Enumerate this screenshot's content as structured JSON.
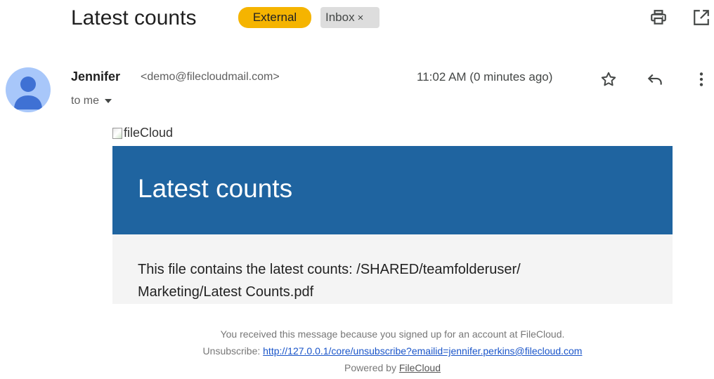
{
  "email": {
    "subject": "Latest counts",
    "labels": {
      "external": "External",
      "inbox": "Inbox",
      "inbox_close": "×"
    },
    "icons": {
      "print": "print-icon",
      "open_new_window": "open-in-new-window-icon",
      "star": "star-icon",
      "reply": "reply-icon",
      "more": "more-vertical-icon",
      "avatar": "person-avatar-icon"
    },
    "sender": {
      "name": "Jennifer",
      "email": "<demo@filecloudmail.com>",
      "recipient": "to me",
      "time": "11:02 AM (0 minutes ago)"
    }
  },
  "message": {
    "logo_alt": "fileCloud",
    "banner_title": "Latest counts",
    "body_line1": "This file contains the latest counts: /SHARED/teamfolderuser/",
    "body_line2": "Marketing/Latest Counts.pdf",
    "footer_line1": "You received this message because you signed up for an account at FileCloud.",
    "unsubscribe_label": "Unsubscribe:",
    "unsubscribe_link": "http://127.0.0.1/core/unsubscribe?emailid=jennifer.perkins@filecloud.com",
    "powered_by_label": "Powered by",
    "powered_by_link": "FileCloud"
  },
  "colors": {
    "external_badge": "#f5b400",
    "banner": "#1f64a0",
    "avatar_bg": "#a8c7fa",
    "avatar_fg": "#3f71d4",
    "link": "#1a55c9"
  }
}
